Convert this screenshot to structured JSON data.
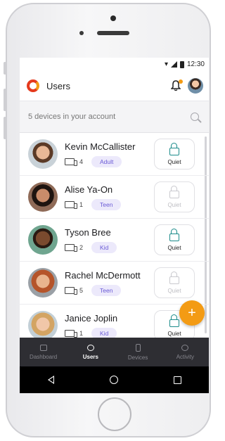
{
  "status_bar": {
    "time": "12:30"
  },
  "app_bar": {
    "title": "Users"
  },
  "search": {
    "text": "5 devices in your account"
  },
  "users": [
    {
      "name": "Kevin McCallister",
      "devices": "4",
      "role": "Adult",
      "quiet": "Quiet",
      "quiet_enabled": true
    },
    {
      "name": "Alise Ya-On",
      "devices": "1",
      "role": "Teen",
      "quiet": "Quiet",
      "quiet_enabled": false
    },
    {
      "name": "Tyson Bree",
      "devices": "2",
      "role": "Kid",
      "quiet": "Quiet",
      "quiet_enabled": true
    },
    {
      "name": "Rachel McDermott",
      "devices": "5",
      "role": "Teen",
      "quiet": "Quiet",
      "quiet_enabled": false
    },
    {
      "name": "Janice Joplin",
      "devices": "1",
      "role": "Kid",
      "quiet": "Quiet",
      "quiet_enabled": true
    }
  ],
  "fab": {
    "label": "+"
  },
  "tabs": [
    {
      "label": "Dashboard",
      "active": false
    },
    {
      "label": "Users",
      "active": true
    },
    {
      "label": "Devices",
      "active": false
    },
    {
      "label": "Activity",
      "active": false
    }
  ],
  "colors": {
    "accent": "#f39b14",
    "quiet_on": "#1b8b8a",
    "badge_text": "#6b5bd6",
    "tabbar": "#2e2e33"
  }
}
